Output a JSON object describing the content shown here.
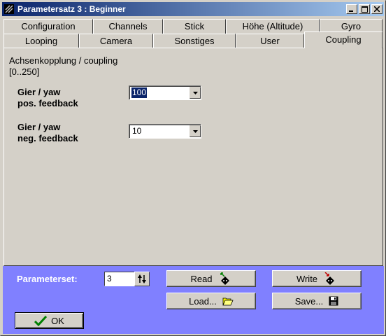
{
  "window": {
    "title": "Parametersatz 3 : Beginner"
  },
  "tabs_row1": [
    {
      "label": "Configuration"
    },
    {
      "label": "Channels"
    },
    {
      "label": "Stick"
    },
    {
      "label": "Höhe (Altitude)"
    },
    {
      "label": "Gyro"
    }
  ],
  "tabs_row2": [
    {
      "label": "Looping"
    },
    {
      "label": "Camera"
    },
    {
      "label": "Sonstiges"
    },
    {
      "label": "User"
    },
    {
      "label": "Coupling",
      "active": true
    }
  ],
  "panel": {
    "section_title": "Achsenkopplung / coupling",
    "range": "[0..250]",
    "fields": [
      {
        "label_line1": "Gier / yaw",
        "label_line2": "pos. feedback",
        "value": "100",
        "selected": true
      },
      {
        "label_line1": "Gier / yaw",
        "label_line2": "neg. feedback",
        "value": "10",
        "selected": false
      }
    ]
  },
  "bottom": {
    "parameterset_label": "Parameterset:",
    "parameterset_value": "3",
    "read_label": "Read",
    "write_label": "Write",
    "load_label": "Load...",
    "save_label": "Save...",
    "ok_label": "OK"
  },
  "colors": {
    "titlebar_start": "#0a246a",
    "titlebar_end": "#a6caf0",
    "bottom_panel": "#8080ff",
    "face": "#d4d0c8",
    "ok_check": "#008000"
  },
  "icons": {
    "app": "app-icon",
    "minimize": "minimize-icon",
    "maximize": "maximize-icon",
    "close": "close-icon",
    "read": "read-device-icon",
    "write": "write-device-icon",
    "load": "folder-open-icon",
    "save": "floppy-disk-icon",
    "ok": "checkmark-icon"
  }
}
